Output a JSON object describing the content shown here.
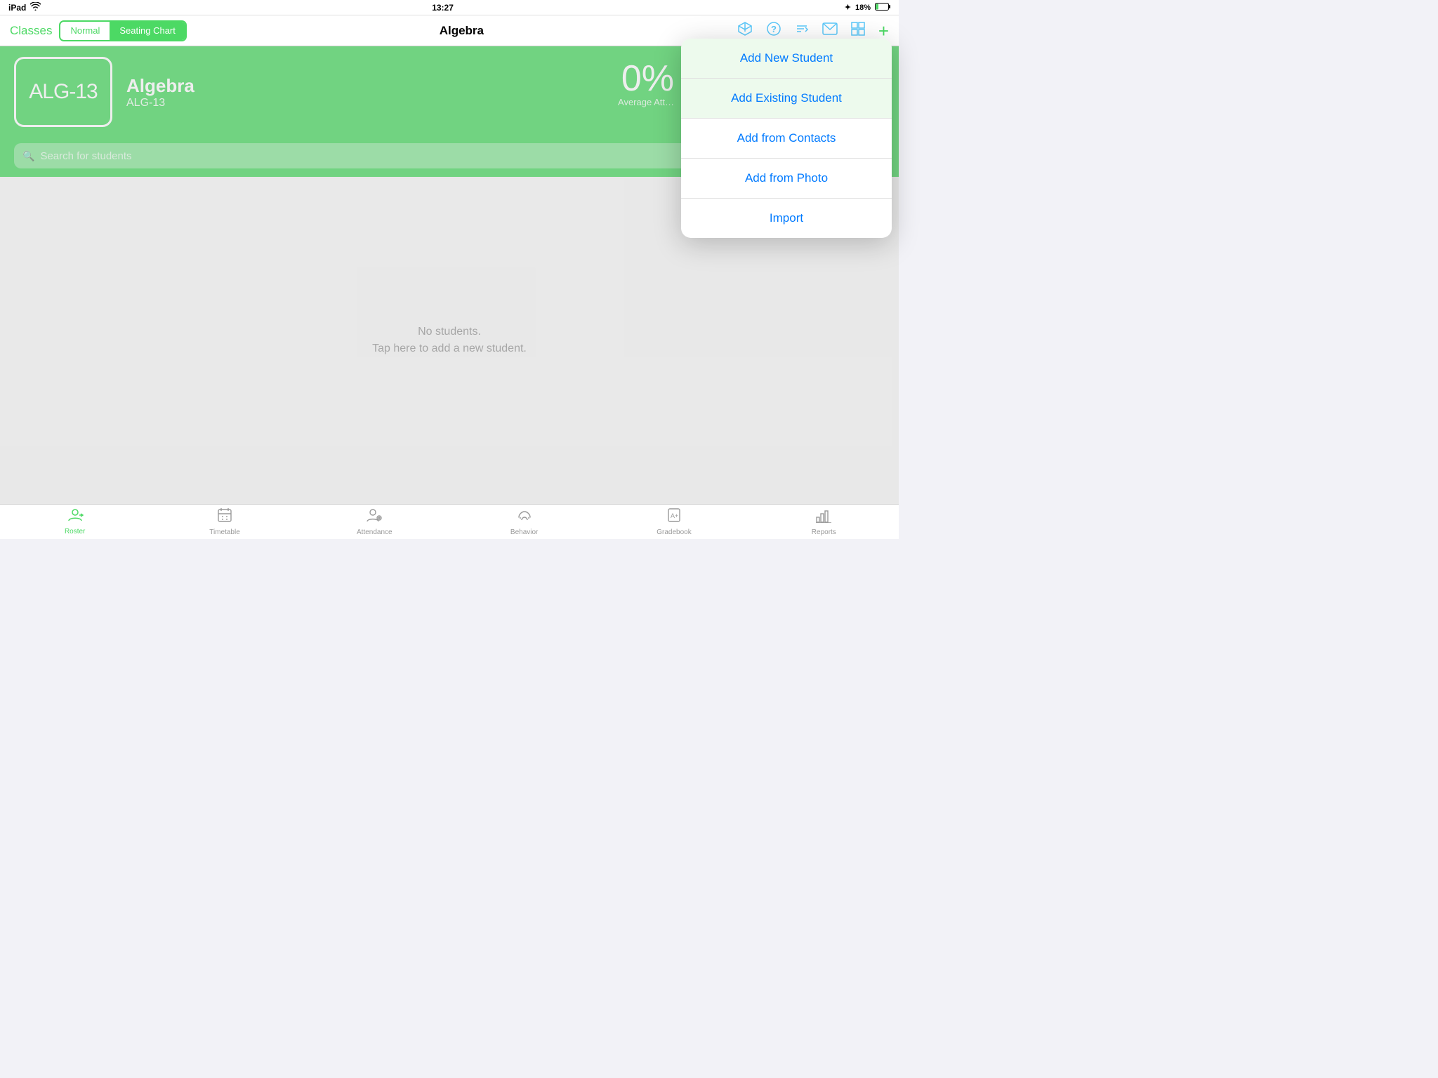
{
  "statusBar": {
    "left": "iPad",
    "wifi": "wifi",
    "time": "13:27",
    "bluetooth": "✦",
    "battery": "18%"
  },
  "navBar": {
    "classesLabel": "Classes",
    "segmentNormal": "Normal",
    "segmentSeatingChart": "Seating Chart",
    "title": "Algebra",
    "icons": [
      "3d-box-icon",
      "question-icon",
      "import-icon",
      "mail-icon",
      "layout-icon",
      "plus-icon"
    ]
  },
  "header": {
    "badgeText": "ALG-13",
    "className": "Algebra",
    "classCode": "ALG-13",
    "statsPercent": "0%",
    "statsLabel": "Average Att…"
  },
  "searchBar": {
    "placeholder": "Search for students"
  },
  "mainContent": {
    "emptyLine1": "No students.",
    "emptyLine2": "Tap here to add a new student."
  },
  "popover": {
    "items": [
      {
        "label": "Add New Student",
        "highlight": true
      },
      {
        "label": "Add Existing Student",
        "highlight": true
      },
      {
        "label": "Add from Contacts",
        "highlight": false
      },
      {
        "label": "Add from Photo",
        "highlight": false
      },
      {
        "label": "Import",
        "highlight": false
      }
    ]
  },
  "tabBar": {
    "tabs": [
      {
        "id": "roster",
        "icon": "🎓",
        "label": "Roster",
        "active": true
      },
      {
        "id": "timetable",
        "icon": "📅",
        "label": "Timetable",
        "active": false
      },
      {
        "id": "attendance",
        "icon": "👤",
        "label": "Attendance",
        "active": false
      },
      {
        "id": "behavior",
        "icon": "👍",
        "label": "Behavior",
        "active": false
      },
      {
        "id": "gradebook",
        "icon": "📝",
        "label": "Gradebook",
        "active": false
      },
      {
        "id": "reports",
        "icon": "📊",
        "label": "Reports",
        "active": false
      }
    ]
  }
}
